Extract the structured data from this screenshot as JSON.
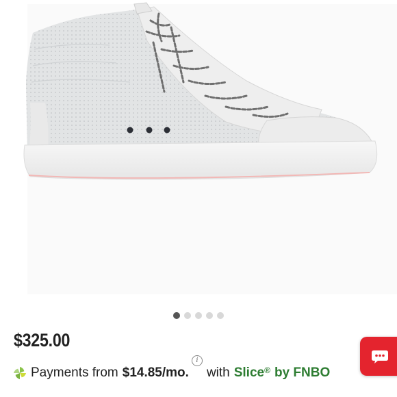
{
  "product": {
    "image_icon": "sneaker-image",
    "carousel": {
      "count": 5,
      "active_index": 0
    },
    "price": "$325.00"
  },
  "financing": {
    "logo_icon": "slice-pinwheel-icon",
    "prefix": "Payments from",
    "amount": "$14.85/mo.",
    "info_icon": "info-icon",
    "info_glyph": "i",
    "with_text": "with",
    "provider": "Slice",
    "registered_mark": "®",
    "by_text": "by FNBO"
  },
  "chat": {
    "icon": "chat-bubble-icon"
  },
  "colors": {
    "price": "#222222",
    "provider_green": "#2e7d32",
    "chat_red": "#e4242e",
    "dot_active": "#555555",
    "dot_inactive": "#d8d8d8"
  }
}
